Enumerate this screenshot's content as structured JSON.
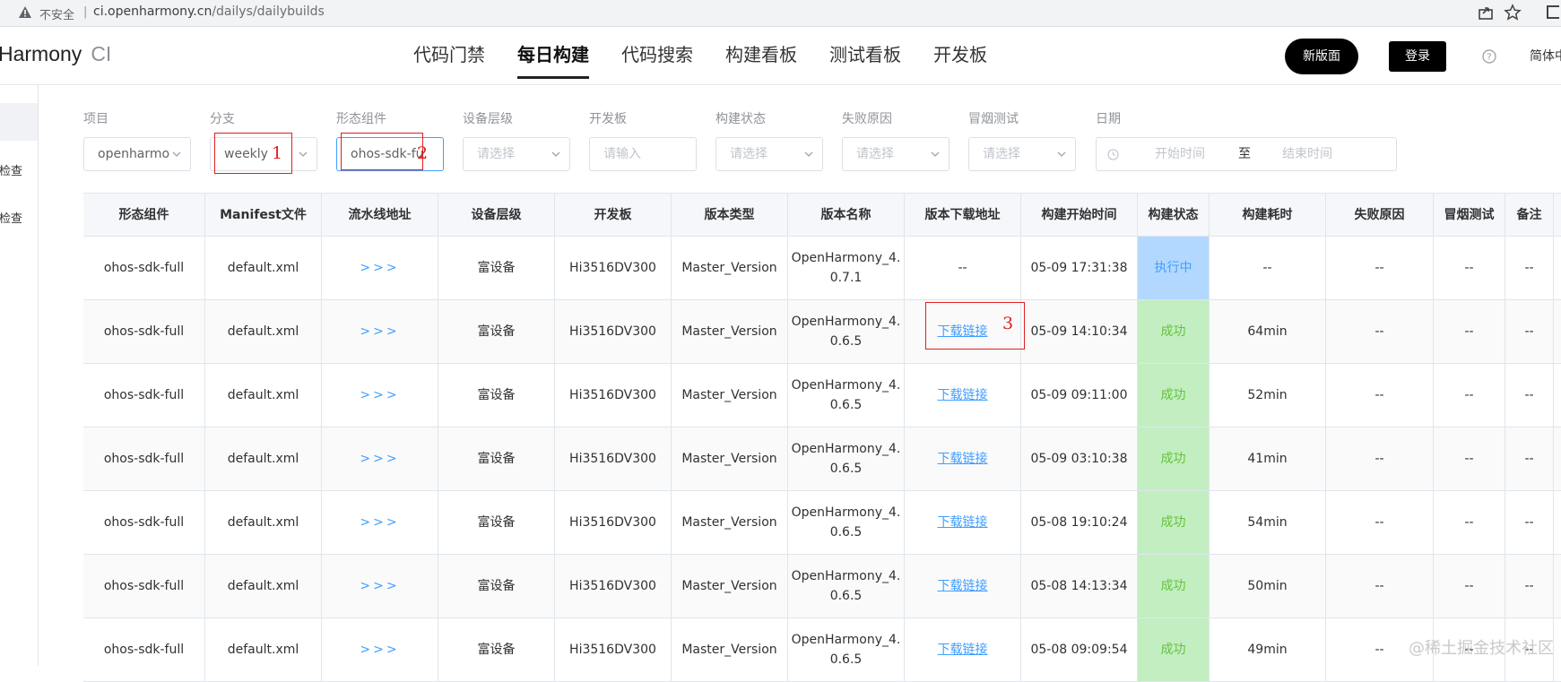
{
  "browser": {
    "insecure_label": "不安全",
    "url_host": "ci.openharmony.cn",
    "url_path": "/dailys/dailybuilds"
  },
  "header": {
    "logo_main": "Harmony",
    "logo_ci": "CI",
    "tabs": [
      {
        "label": "代码门禁"
      },
      {
        "label": "每日构建",
        "active": true
      },
      {
        "label": "代码搜索"
      },
      {
        "label": "构建看板"
      },
      {
        "label": "测试看板"
      },
      {
        "label": "开发板"
      }
    ],
    "new_version_button": "新版面",
    "login_button": "登录",
    "language": "简体中"
  },
  "sidebar": {
    "items": [
      {
        "label": "检查"
      },
      {
        "label": "检查"
      }
    ]
  },
  "filters": {
    "project": {
      "label": "项目",
      "value": "openharmo"
    },
    "branch": {
      "label": "分支",
      "value": "weekly"
    },
    "component": {
      "label": "形态组件",
      "value": "ohos-sdk-fu"
    },
    "device_level": {
      "label": "设备层级",
      "placeholder": "请选择"
    },
    "dev_board": {
      "label": "开发板",
      "placeholder": "请输入"
    },
    "build_status": {
      "label": "构建状态",
      "placeholder": "请选择"
    },
    "fail_reason": {
      "label": "失败原因",
      "placeholder": "请选择"
    },
    "smoke_test": {
      "label": "冒烟测试",
      "placeholder": "请选择"
    },
    "date": {
      "label": "日期",
      "start_placeholder": "开始时间",
      "separator": "至",
      "end_placeholder": "结束时间"
    }
  },
  "table": {
    "headers": [
      "形态组件",
      "Manifest文件",
      "流水线地址",
      "设备层级",
      "开发板",
      "版本类型",
      "版本名称",
      "版本下载地址",
      "构建开始时间",
      "构建状态",
      "构建耗时",
      "失败原因",
      "冒烟测试",
      "备注"
    ],
    "rows": [
      {
        "component": "ohos-sdk-full",
        "manifest": "default.xml",
        "pipeline": ">>>",
        "device_level": "富设备",
        "board": "Hi3516DV300",
        "version_type": "Master_Version",
        "version_name": "OpenHarmony_4.0.7.1",
        "download": "--",
        "start_time": "05-09 17:31:38",
        "status": "执行中",
        "status_kind": "running",
        "duration": "--",
        "fail_reason": "--",
        "smoke_test": "--",
        "remark": "--"
      },
      {
        "component": "ohos-sdk-full",
        "manifest": "default.xml",
        "pipeline": ">>>",
        "device_level": "富设备",
        "board": "Hi3516DV300",
        "version_type": "Master_Version",
        "version_name": "OpenHarmony_4.0.6.5",
        "download": "下载链接",
        "start_time": "05-09 14:10:34",
        "status": "成功",
        "status_kind": "success",
        "duration": "64min",
        "fail_reason": "--",
        "smoke_test": "--",
        "remark": "--"
      },
      {
        "component": "ohos-sdk-full",
        "manifest": "default.xml",
        "pipeline": ">>>",
        "device_level": "富设备",
        "board": "Hi3516DV300",
        "version_type": "Master_Version",
        "version_name": "OpenHarmony_4.0.6.5",
        "download": "下载链接",
        "start_time": "05-09 09:11:00",
        "status": "成功",
        "status_kind": "success",
        "duration": "52min",
        "fail_reason": "--",
        "smoke_test": "--",
        "remark": "--"
      },
      {
        "component": "ohos-sdk-full",
        "manifest": "default.xml",
        "pipeline": ">>>",
        "device_level": "富设备",
        "board": "Hi3516DV300",
        "version_type": "Master_Version",
        "version_name": "OpenHarmony_4.0.6.5",
        "download": "下载链接",
        "start_time": "05-09 03:10:38",
        "status": "成功",
        "status_kind": "success",
        "duration": "41min",
        "fail_reason": "--",
        "smoke_test": "--",
        "remark": "--"
      },
      {
        "component": "ohos-sdk-full",
        "manifest": "default.xml",
        "pipeline": ">>>",
        "device_level": "富设备",
        "board": "Hi3516DV300",
        "version_type": "Master_Version",
        "version_name": "OpenHarmony_4.0.6.5",
        "download": "下载链接",
        "start_time": "05-08 19:10:24",
        "status": "成功",
        "status_kind": "success",
        "duration": "54min",
        "fail_reason": "--",
        "smoke_test": "--",
        "remark": "--"
      },
      {
        "component": "ohos-sdk-full",
        "manifest": "default.xml",
        "pipeline": ">>>",
        "device_level": "富设备",
        "board": "Hi3516DV300",
        "version_type": "Master_Version",
        "version_name": "OpenHarmony_4.0.6.5",
        "download": "下载链接",
        "start_time": "05-08 14:13:34",
        "status": "成功",
        "status_kind": "success",
        "duration": "50min",
        "fail_reason": "--",
        "smoke_test": "--",
        "remark": "--"
      },
      {
        "component": "ohos-sdk-full",
        "manifest": "default.xml",
        "pipeline": ">>>",
        "device_level": "富设备",
        "board": "Hi3516DV300",
        "version_type": "Master_Version",
        "version_name": "OpenHarmony_4.0.6.5",
        "download": "下载链接",
        "start_time": "05-08 09:09:54",
        "status": "成功",
        "status_kind": "success",
        "duration": "49min",
        "fail_reason": "--",
        "smoke_test": "--",
        "remark": "--"
      }
    ]
  },
  "annotations": [
    "1",
    "2",
    "3"
  ],
  "watermark": "@稀土掘金技术社区",
  "colors": {
    "accent": "#409eff",
    "success": "#67c23a",
    "running_bg": "#b3d8ff",
    "success_bg": "#c2eec2",
    "annotation": "#e02020"
  }
}
